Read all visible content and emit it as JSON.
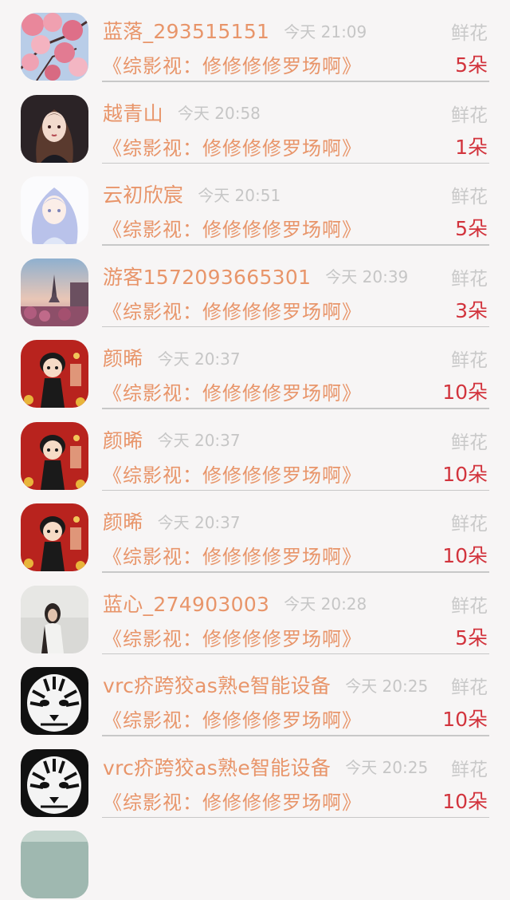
{
  "rows": [
    {
      "name": "蓝落_293515151",
      "time": "今天 21:09",
      "book": "《综影视：修修修修罗场啊》",
      "gift": "鲜花",
      "count": "5朵",
      "avatar": "cherry-blossom"
    },
    {
      "name": "越青山",
      "time": "今天 20:58",
      "book": "《综影视：修修修修罗场啊》",
      "gift": "鲜花",
      "count": "1朵",
      "avatar": "dark-girl"
    },
    {
      "name": "云初欣宸",
      "time": "今天 20:51",
      "book": "《综影视：修修修修罗场啊》",
      "gift": "鲜花",
      "count": "5朵",
      "avatar": "blue-hair-girl"
    },
    {
      "name": "游客1572093665301",
      "time": "今天 20:39",
      "book": "《综影视：修修修修罗场啊》",
      "gift": "鲜花",
      "count": "3朵",
      "avatar": "paris"
    },
    {
      "name": "颜晞",
      "time": "今天 20:37",
      "book": "《综影视：修修修修罗场啊》",
      "gift": "鲜花",
      "count": "10朵",
      "avatar": "red-cartoon"
    },
    {
      "name": "颜晞",
      "time": "今天 20:37",
      "book": "《综影视：修修修修罗场啊》",
      "gift": "鲜花",
      "count": "10朵",
      "avatar": "red-cartoon"
    },
    {
      "name": "颜晞",
      "time": "今天 20:37",
      "book": "《综影视：修修修修罗场啊》",
      "gift": "鲜花",
      "count": "10朵",
      "avatar": "red-cartoon"
    },
    {
      "name": "蓝心_274903003",
      "time": "今天 20:28",
      "book": "《综影视：修修修修罗场啊》",
      "gift": "鲜花",
      "count": "5朵",
      "avatar": "woman-photo"
    },
    {
      "name": "vrc疥跨狡as熟e智能设备",
      "time": "今天 20:25",
      "book": "《综影视：修修修修罗场啊》",
      "gift": "鲜花",
      "count": "10朵",
      "avatar": "tiger"
    },
    {
      "name": "vrc疥跨狡as熟e智能设备",
      "time": "今天 20:25",
      "book": "《综影视：修修修修罗场啊》",
      "gift": "鲜花",
      "count": "10朵",
      "avatar": "tiger"
    }
  ]
}
